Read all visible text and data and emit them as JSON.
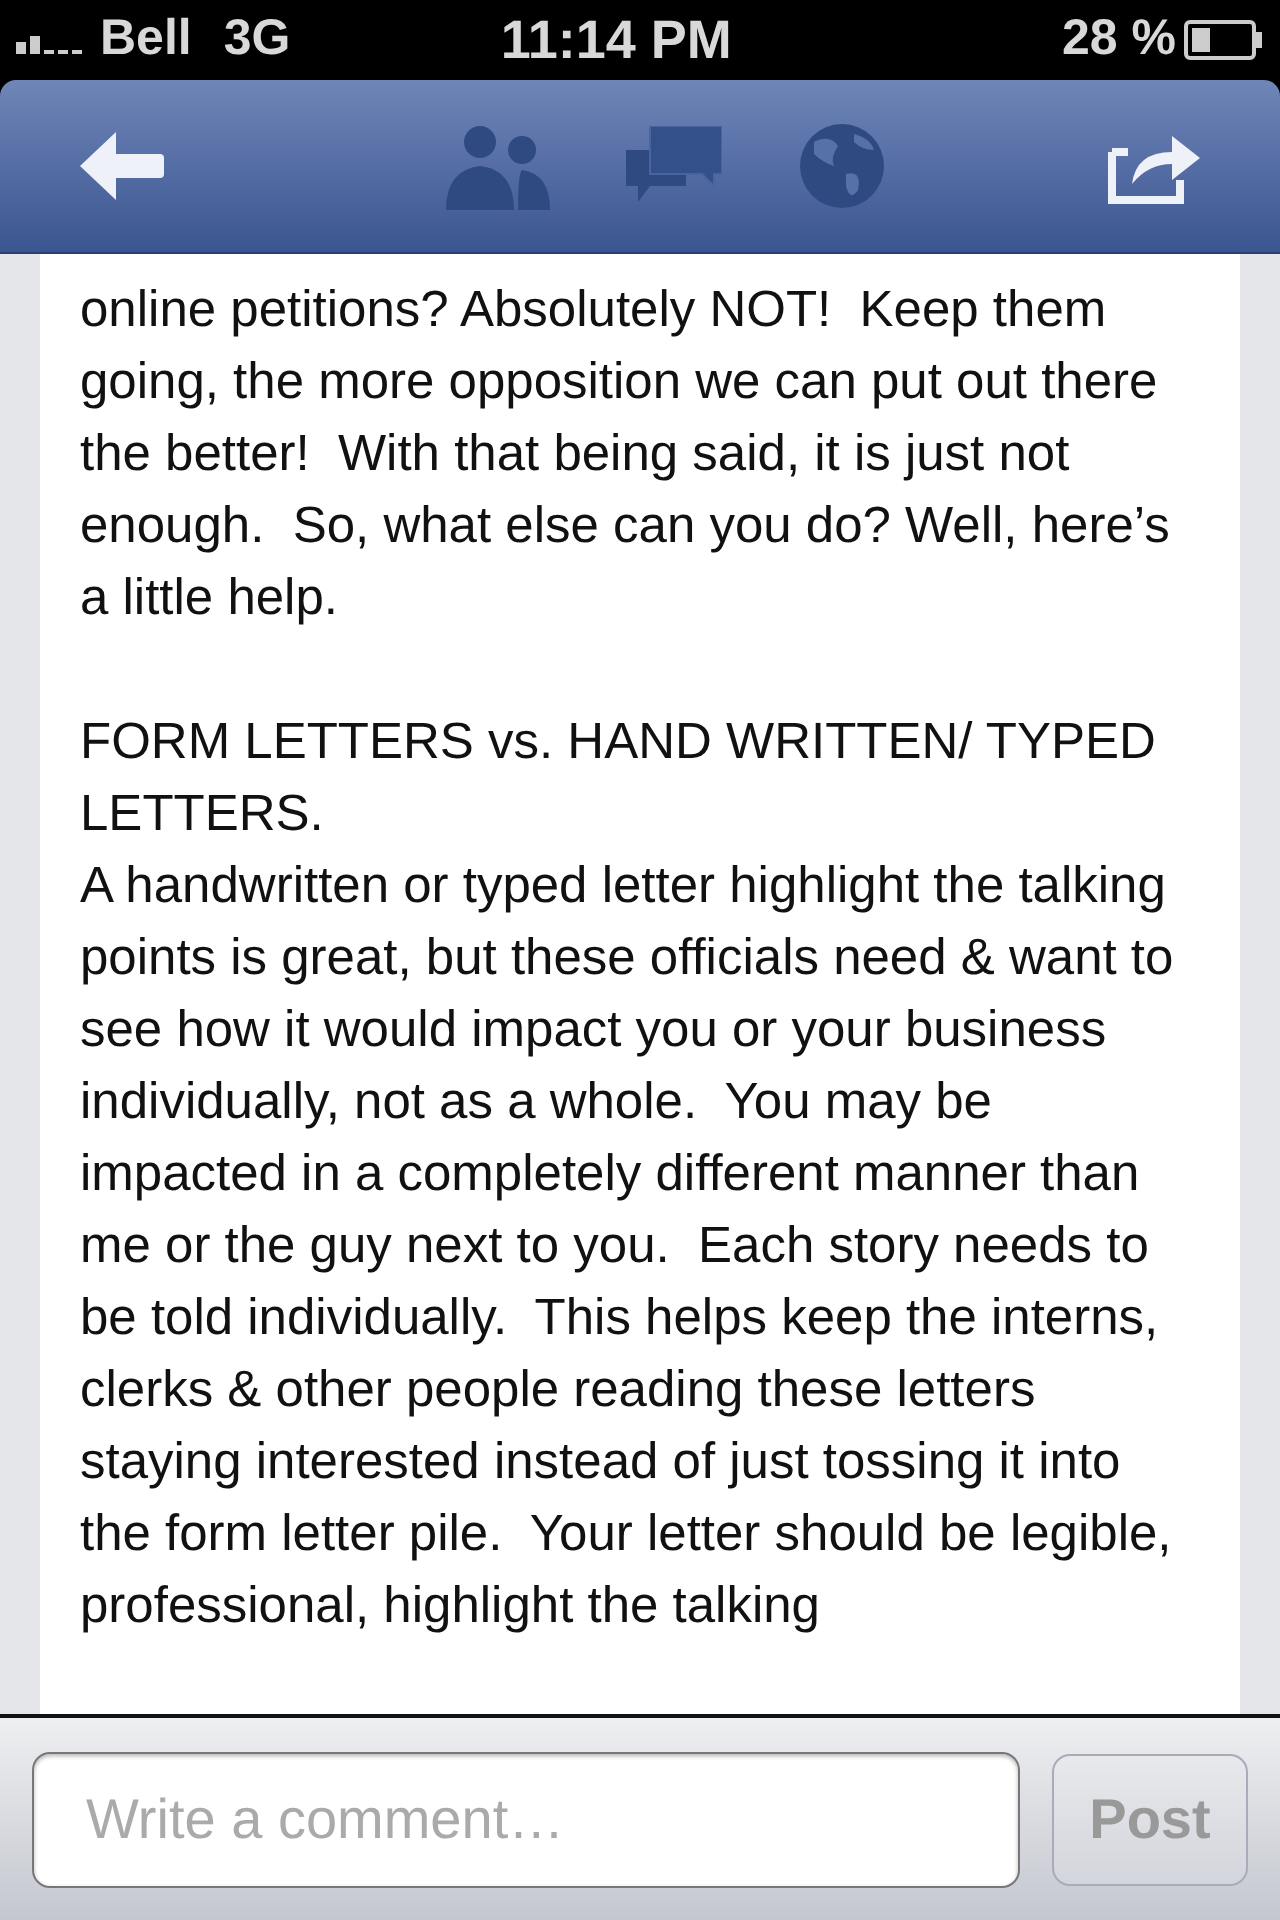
{
  "status_bar": {
    "carrier": "Bell",
    "network": "3G",
    "time": "11:14 PM",
    "battery": "28 %"
  },
  "post": {
    "paragraphs": [
      {
        "kind": "text",
        "text": "online petitions? Absolutely NOT!  Keep them going, the more opposition we can put out there the better!  With that being said, it is just not enough.  So, what else can you do? Well, here’s a little help."
      },
      {
        "kind": "heading",
        "text": "FORM LETTERS vs. HAND WRITTEN/ TYPED LETTERS."
      },
      {
        "kind": "text",
        "text": "A handwritten or typed letter highlight the talking points is great, but these officials need & want to see how it would impact you or your business individually, not as a whole.  You may be impacted in a completely different manner than me or the guy next to you.  Each story needs to be told individually.  This helps keep the interns, clerks & other people reading these letters staying interested instead of just tossing it into the form letter pile.  Your letter should be legible, professional, highlight the talking"
      }
    ]
  },
  "comment_bar": {
    "placeholder": "Write a comment…",
    "post_button": {
      "label": "Post",
      "disabled": true
    }
  }
}
